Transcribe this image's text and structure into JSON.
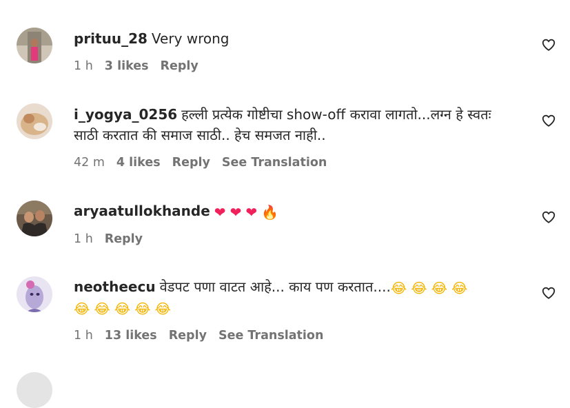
{
  "comments": [
    {
      "username": "prituu_28",
      "text": "Very wrong",
      "time": "1 h",
      "likes": "3 likes",
      "reply": "Reply",
      "translation": ""
    },
    {
      "username": "i_yogya_0256",
      "text": "हल्ली प्रत्येक गोष्टीचा show-off करावा लागतो...लग्न हे स्वतः साठी करतात की समाज साठी.. हेच समजत नाही..",
      "time": "42 m",
      "likes": "4 likes",
      "reply": "Reply",
      "translation": "See Translation"
    },
    {
      "username": "aryaatullokhande",
      "text": "",
      "time": "1 h",
      "likes": "",
      "reply": "Reply",
      "translation": "",
      "emojis": [
        "❤",
        "❤",
        "❤",
        "🔥"
      ]
    },
    {
      "username": "neotheecu",
      "text": "वेडपट पणा वाटत आहे... काय पण करतात....",
      "time": "1 h",
      "likes": "13 likes",
      "reply": "Reply",
      "translation": "See Translation",
      "emojis": [
        "😂",
        "😂",
        "😂",
        "😂",
        "😂",
        "😂",
        "😂",
        "😂",
        "😂"
      ]
    }
  ],
  "icons": {
    "like": "heart-outline-icon"
  },
  "colors": {
    "text": "#262626",
    "meta": "#737373",
    "heart": "#f0205a"
  }
}
